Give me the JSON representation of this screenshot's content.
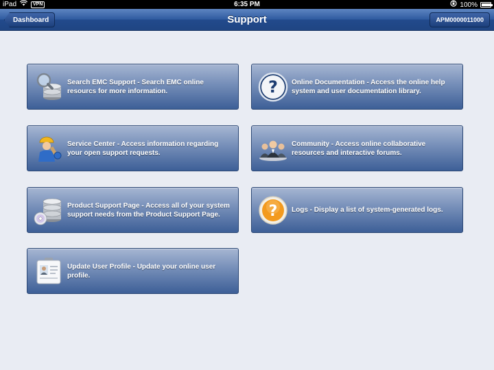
{
  "status_bar": {
    "device": "iPad",
    "vpn": "VPN",
    "time": "6:35 PM",
    "battery": "100%",
    "battery_level": 1.0
  },
  "nav": {
    "title": "Support",
    "back_label": "Dashboard",
    "account_label": "APM0000011000"
  },
  "tiles": [
    {
      "icon": "search-database-icon",
      "label": "Search EMC Support - Search EMC online resourcs for more information."
    },
    {
      "icon": "question-mark-icon",
      "label": "Online Documentation - Access the online help system and user documentation library."
    },
    {
      "icon": "service-worker-icon",
      "label": "Service Center - Access information regarding your open support requests."
    },
    {
      "icon": "community-people-icon",
      "label": "Community - Access online collaborative resources and interactive forums."
    },
    {
      "icon": "database-disc-icon",
      "label": "Product Support Page - Access all of your system support needs from the Product Support Page."
    },
    {
      "icon": "logs-question-icon",
      "label": "Logs - Display a list of system-generated logs."
    },
    {
      "icon": "id-badge-icon",
      "label": "Update User Profile - Update your online user profile."
    }
  ],
  "colors": {
    "nav_blue": "#2e5a9f",
    "tile_top": "#a6b6d2",
    "tile_bottom": "#3d5f97",
    "background": "#e9ecf3"
  }
}
